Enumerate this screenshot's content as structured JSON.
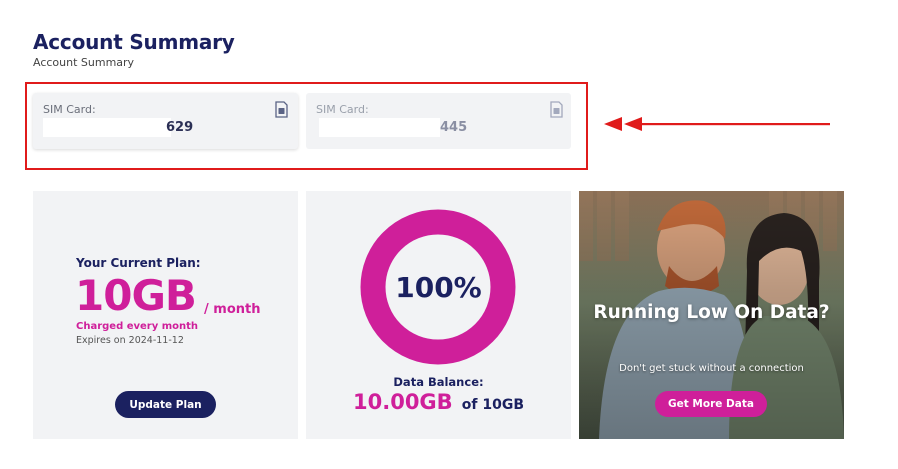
{
  "header": {
    "title": "Account Summary",
    "breadcrumb": "Account Summary"
  },
  "sim_cards": [
    {
      "label": "SIM Card:",
      "number_suffix": "629",
      "state": "selected",
      "icon": "sim-card-icon"
    },
    {
      "label": "SIM Card:",
      "number_suffix": "445",
      "state": "unselected",
      "icon": "sim-card-icon"
    }
  ],
  "plan": {
    "heading": "Your Current Plan:",
    "amount": "10GB",
    "period": "/ month",
    "charge_note": "Charged every month",
    "expiry": "Expires on 2024-11-12",
    "button": "Update Plan"
  },
  "balance": {
    "percent_text": "100%",
    "percent_value": 100,
    "label": "Data Balance:",
    "value": "10.00GB",
    "total": "of 10GB"
  },
  "promo": {
    "title": "Running Low On Data?",
    "subtitle": "Don't get stuck without a connection",
    "button": "Get More Data"
  },
  "colors": {
    "navy": "#1b2160",
    "magenta": "#cf1f9a",
    "card_bg": "#f2f3f5",
    "annotation_red": "#e01b1b"
  }
}
